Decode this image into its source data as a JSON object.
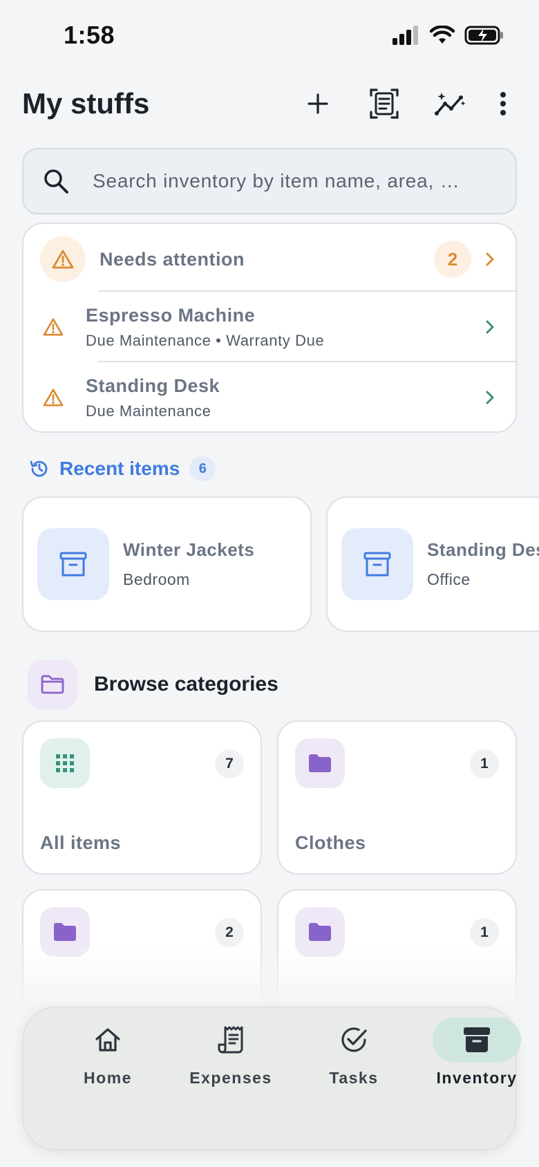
{
  "status_bar": {
    "time": "1:58"
  },
  "header": {
    "title": "My stuffs"
  },
  "search": {
    "placeholder": "Search inventory by item name, area, …"
  },
  "attention": {
    "title": "Needs attention",
    "count": "2",
    "items": [
      {
        "name": "Espresso Machine",
        "detail": "Due Maintenance • Warranty Due"
      },
      {
        "name": "Standing Desk",
        "detail": "Due Maintenance"
      }
    ]
  },
  "recent": {
    "title": "Recent items",
    "count": "6",
    "items": [
      {
        "name": "Winter Jackets",
        "area": "Bedroom"
      },
      {
        "name": "Standing Desk",
        "area": "Office"
      }
    ]
  },
  "browse": {
    "title": "Browse categories",
    "categories": [
      {
        "name": "All items",
        "count": "7",
        "icon": "grid-icon"
      },
      {
        "name": "Clothes",
        "count": "1",
        "icon": "folder-icon"
      },
      {
        "name": "",
        "count": "2",
        "icon": "folder-icon"
      },
      {
        "name": "",
        "count": "1",
        "icon": "folder-icon"
      }
    ]
  },
  "nav": {
    "items": [
      {
        "label": "Home",
        "icon": "home-icon"
      },
      {
        "label": "Expenses",
        "icon": "receipt-icon"
      },
      {
        "label": "Tasks",
        "icon": "check-circle-icon"
      },
      {
        "label": "Inventory",
        "icon": "archive-box-icon"
      }
    ],
    "active": "Inventory"
  },
  "colors": {
    "accent_blue": "#3f7be0",
    "warning_orange": "#d98b32",
    "teal": "#3a8f7c",
    "purple": "#8a63c9"
  }
}
